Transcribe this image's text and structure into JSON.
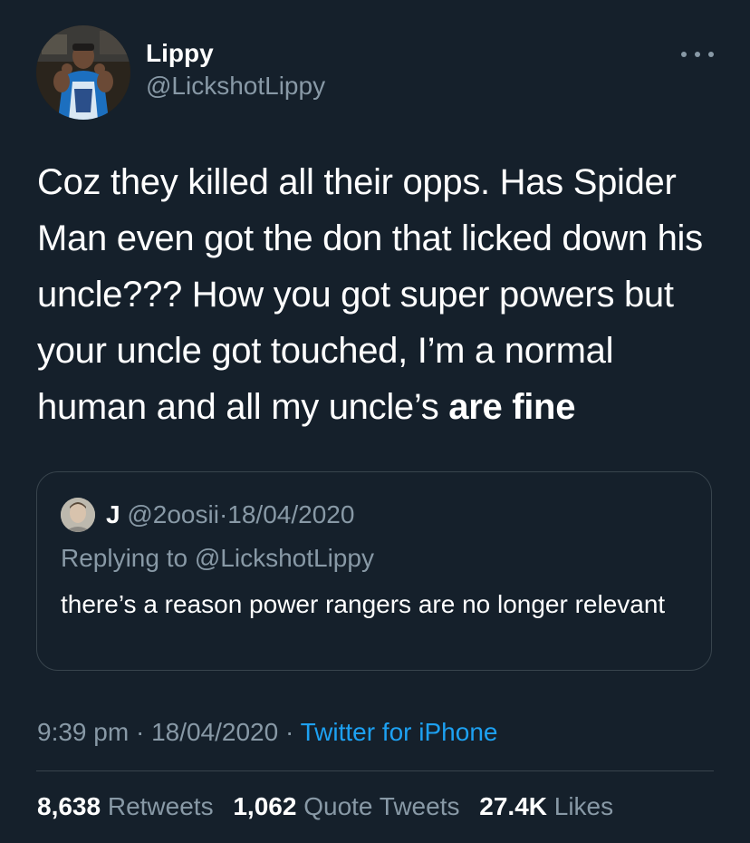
{
  "author": {
    "name": "Lippy",
    "handle": "@LickshotLippy"
  },
  "tweet": {
    "text_plain": "Coz they killed all their opps. Has Spider Man even got the don that licked down his uncle??? How you got super powers but your uncle got touched, I’m a normal human and all my uncle’s ",
    "text_bold": "are fine",
    "time": "9:39 pm",
    "separator": "·",
    "date": "18/04/2020",
    "source": "Twitter for iPhone"
  },
  "quoted_tweet": {
    "name": "J",
    "handle": "@2oosii",
    "separator": "·",
    "date": "18/04/2020",
    "replying_to": "Replying to @LickshotLippy",
    "text": "there’s a reason power rangers are no longer relevant"
  },
  "stats": {
    "retweets_count": "8,638",
    "retweets_label": "Retweets",
    "quotes_count": "1,062",
    "quotes_label": "Quote Tweets",
    "likes_count": "27.4K",
    "likes_label": "Likes"
  },
  "colors": {
    "background": "#15202b",
    "secondary_text": "#8899a6",
    "link": "#1da1f2",
    "border": "#38444d"
  },
  "icons": {
    "more": "more-horizontal-icon"
  }
}
